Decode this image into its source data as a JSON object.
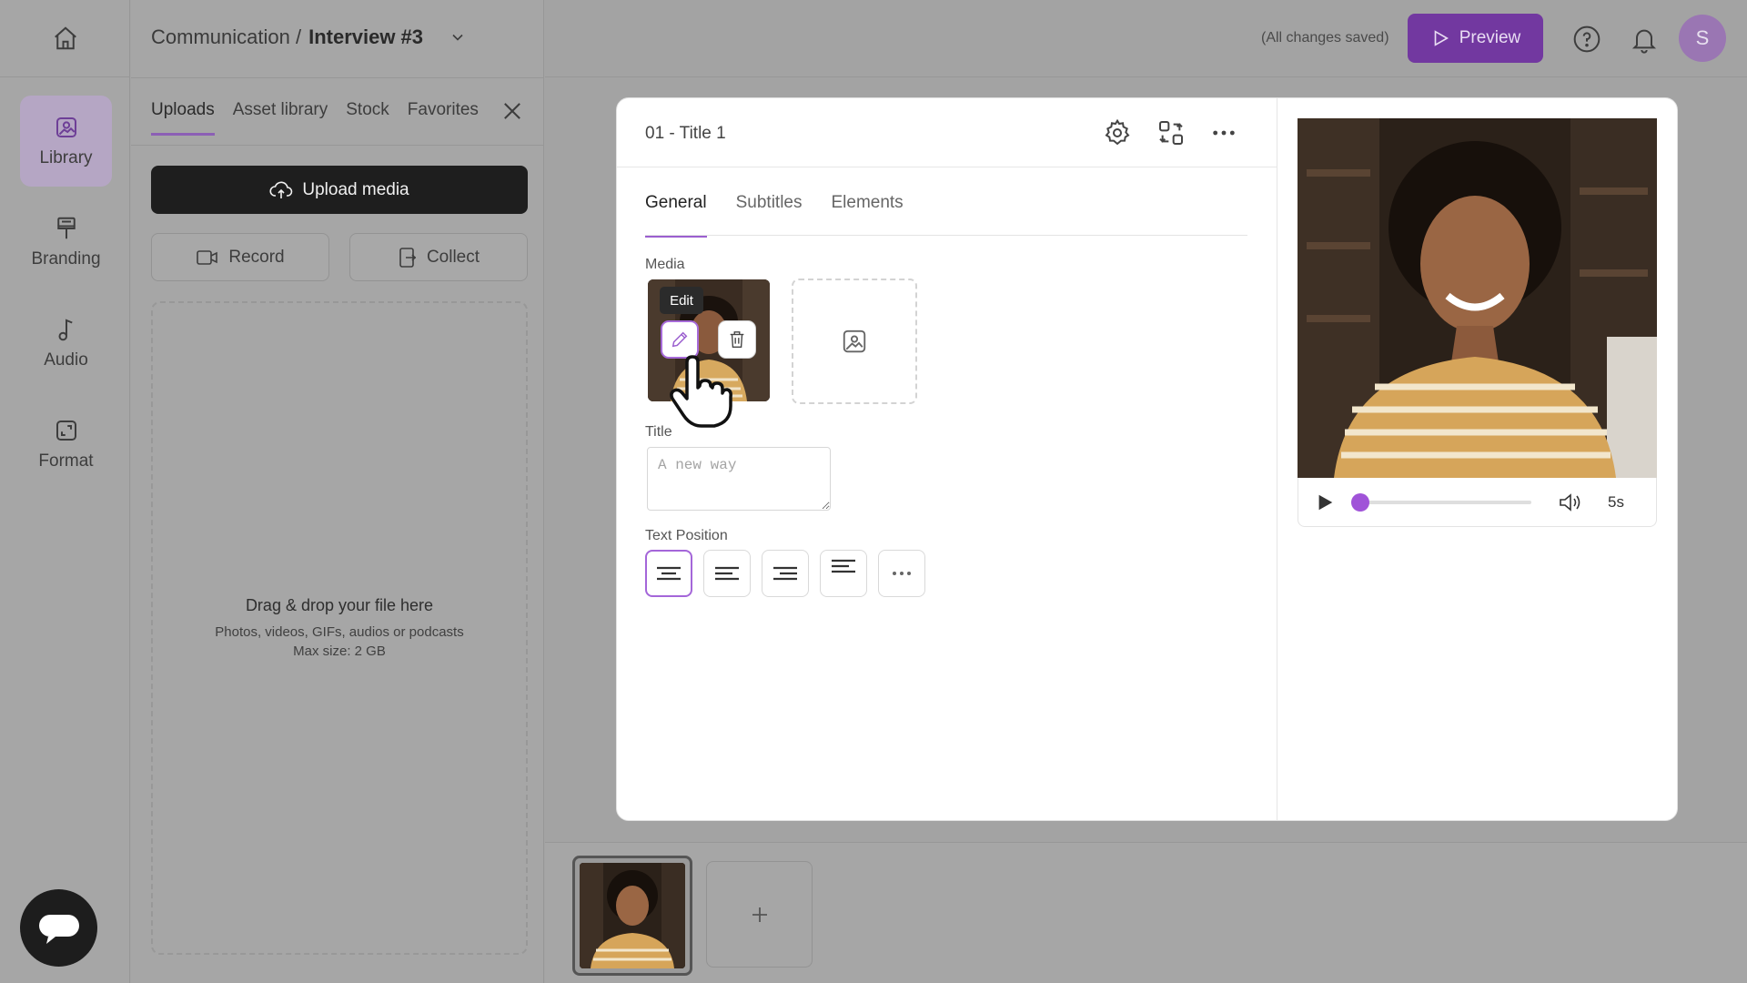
{
  "nav": {
    "items": [
      {
        "label": "Library",
        "icon": "library-icon",
        "active": true
      },
      {
        "label": "Branding",
        "icon": "branding-icon"
      },
      {
        "label": "Audio",
        "icon": "music-note-icon"
      },
      {
        "label": "Format",
        "icon": "format-icon"
      }
    ]
  },
  "breadcrumb": {
    "parent": "Communication /",
    "current": "Interview #3"
  },
  "library": {
    "tabs": [
      "Uploads",
      "Asset library",
      "Stock",
      "Favorites"
    ],
    "active_tab": "Uploads",
    "upload_label": "Upload media",
    "record_label": "Record",
    "collect_label": "Collect",
    "dropzone": {
      "title": "Drag & drop your file here",
      "line1": "Photos, videos, GIFs, audios or podcasts",
      "line2": "Max size: 2 GB"
    }
  },
  "topbar": {
    "status": "(All changes saved)",
    "preview_label": "Preview",
    "avatar_initial": "S"
  },
  "editor": {
    "scene_title": "01 - Title 1",
    "tabs": [
      "General",
      "Subtitles",
      "Elements"
    ],
    "active_tab": "General",
    "media_label": "Media",
    "edit_tooltip": "Edit",
    "title_label": "Title",
    "title_placeholder": "A new way",
    "text_position_label": "Text Position"
  },
  "player": {
    "duration": "5s",
    "progress": 0.0
  },
  "colors": {
    "accent": "#7238a0",
    "accent_light": "#a053d8"
  }
}
